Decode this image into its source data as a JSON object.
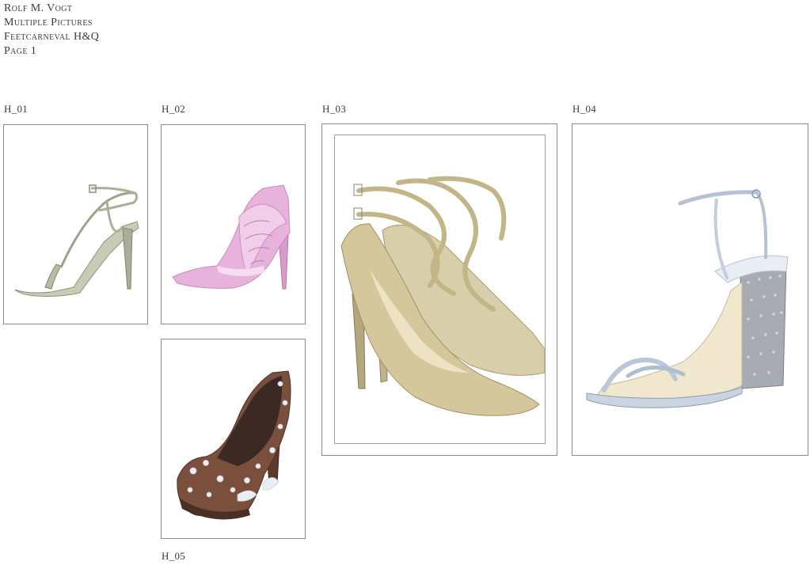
{
  "header": {
    "line1": "Rolf M. Vogt",
    "line2": "Multiple Pictures",
    "line3": "Feetcarneval H&Q",
    "line4": "Page 1"
  },
  "items": [
    {
      "label": "H_01",
      "image": "silver strappy stiletto sandal",
      "accent": "#b9bfa8"
    },
    {
      "label": "H_02",
      "image": "pink embellished pointed pump",
      "accent": "#e3a8d6"
    },
    {
      "label": "H_03",
      "image": "gold metallic strappy pointed pumps",
      "accent": "#c9bd95"
    },
    {
      "label": "H_04",
      "image": "silver ankle strap sandal with crystal block heel",
      "accent": "#b8c6d8"
    },
    {
      "label": "H_05",
      "image": "chocolate brown embellished platform pump",
      "accent": "#7a4f3c"
    }
  ]
}
